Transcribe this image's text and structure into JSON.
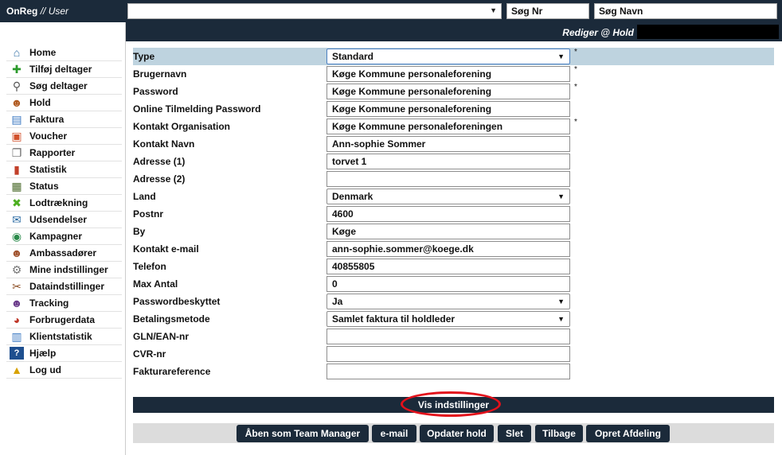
{
  "header": {
    "brand": "OnReg",
    "brand_suffix": "// User",
    "search_nr_placeholder": "Søg Nr",
    "search_name_placeholder": "Søg Navn"
  },
  "subheader": {
    "title": "Rediger @ Hold"
  },
  "sidebar": {
    "items": [
      {
        "label": "Home",
        "icon": "home-icon"
      },
      {
        "label": "Tilføj deltager",
        "icon": "add-user-icon"
      },
      {
        "label": "Søg deltager",
        "icon": "search-user-icon"
      },
      {
        "label": "Hold",
        "icon": "team-icon"
      },
      {
        "label": "Faktura",
        "icon": "invoice-icon"
      },
      {
        "label": "Voucher",
        "icon": "gift-icon"
      },
      {
        "label": "Rapporter",
        "icon": "reports-icon"
      },
      {
        "label": "Statistik",
        "icon": "bar-chart-icon"
      },
      {
        "label": "Status",
        "icon": "status-icon"
      },
      {
        "label": "Lodtrækning",
        "icon": "shuffle-icon"
      },
      {
        "label": "Udsendelser",
        "icon": "broadcast-icon"
      },
      {
        "label": "Kampagner",
        "icon": "globe-icon"
      },
      {
        "label": "Ambassadører",
        "icon": "ambassadors-icon"
      },
      {
        "label": "Mine indstillinger",
        "icon": "gear-icon"
      },
      {
        "label": "Dataindstillinger",
        "icon": "tools-icon"
      },
      {
        "label": "Tracking",
        "icon": "tracking-users-icon"
      },
      {
        "label": "Forbrugerdata",
        "icon": "pie-chart-icon"
      },
      {
        "label": "Klientstatistik",
        "icon": "client-stats-icon"
      },
      {
        "label": "Hjælp",
        "icon": "help-icon"
      },
      {
        "label": "Log ud",
        "icon": "lock-icon"
      }
    ]
  },
  "form": {
    "fields": [
      {
        "label": "Type",
        "value": "Standard",
        "kind": "select",
        "required": true
      },
      {
        "label": "Brugernavn",
        "value": "Køge Kommune personaleforening",
        "kind": "text",
        "required": true
      },
      {
        "label": "Password",
        "value": "Køge Kommune personaleforening",
        "kind": "text",
        "required": true
      },
      {
        "label": "Online Tilmelding Password",
        "value": "Køge Kommune personaleforening",
        "kind": "text",
        "required": false
      },
      {
        "label": "Kontakt Organisation",
        "value": "Køge Kommune personaleforeningen",
        "kind": "text",
        "required": true
      },
      {
        "label": "Kontakt Navn",
        "value": "Ann-sophie Sommer",
        "kind": "text",
        "required": false
      },
      {
        "label": "Adresse (1)",
        "value": "torvet 1",
        "kind": "text",
        "required": false
      },
      {
        "label": "Adresse (2)",
        "value": "",
        "kind": "text",
        "required": false
      },
      {
        "label": "Land",
        "value": "Denmark",
        "kind": "select",
        "required": false
      },
      {
        "label": "Postnr",
        "value": "4600",
        "kind": "text",
        "required": false
      },
      {
        "label": "By",
        "value": "Køge",
        "kind": "text",
        "required": false
      },
      {
        "label": "Kontakt e-mail",
        "value": "ann-sophie.sommer@koege.dk",
        "kind": "text",
        "required": false
      },
      {
        "label": "Telefon",
        "value": "40855805",
        "kind": "text",
        "required": false
      },
      {
        "label": "Max Antal",
        "value": "0",
        "kind": "text",
        "required": false
      },
      {
        "label": "Passwordbeskyttet",
        "value": "Ja",
        "kind": "select",
        "required": false
      },
      {
        "label": "Betalingsmetode",
        "value": "Samlet faktura til holdleder",
        "kind": "select",
        "required": false
      },
      {
        "label": "GLN/EAN-nr",
        "value": "",
        "kind": "text",
        "required": false
      },
      {
        "label": "CVR-nr",
        "value": "",
        "kind": "text",
        "required": false
      },
      {
        "label": "Fakturareference",
        "value": "",
        "kind": "text",
        "required": false
      }
    ],
    "required_marker": "*"
  },
  "vis_indstillinger": "Vis indstillinger",
  "buttons": {
    "team_manager": "Åben som Team Manager",
    "email": "e-mail",
    "update": "Opdater hold",
    "delete": "Slet",
    "back": "Tilbage",
    "create_dept": "Opret Afdeling"
  },
  "colors": {
    "navy": "#1b2a3a",
    "highlight_row": "#bed3df",
    "annotation_ring": "#e3111b"
  }
}
